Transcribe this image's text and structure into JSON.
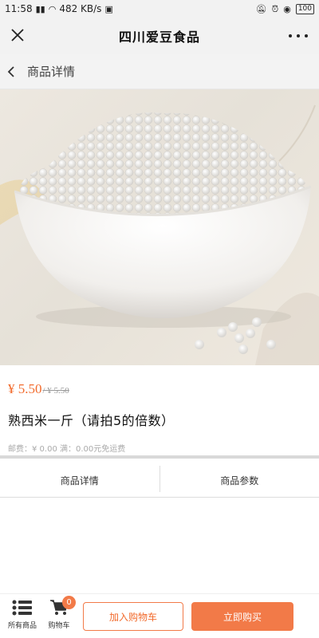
{
  "status_bar": {
    "time": "11:58",
    "net_speed": "482 KB/s",
    "battery": "100"
  },
  "title_bar": {
    "title": "四川爱豆食品",
    "close_icon": "close-icon",
    "more_icon": "more-icon"
  },
  "sub_header": {
    "title": "商品详情",
    "back_icon": "back-icon"
  },
  "product": {
    "price": "¥ 5.50",
    "old_price": "/ ¥ 5.50",
    "name": "熟西米一斤（请拍5的倍数）",
    "shipping": "邮费：¥ 0.00 满：0.00元免运费",
    "image": "white-tapioca-pearls-in-bowl"
  },
  "tabs": [
    {
      "label": "商品详情"
    },
    {
      "label": "商品参数"
    }
  ],
  "bottom_bar": {
    "all_products_label": "所有商品",
    "cart_label": "购物车",
    "cart_count": "0",
    "add_to_cart_label": "加入购物车",
    "buy_now_label": "立即购买"
  },
  "colors": {
    "accent": "#f27a48",
    "price": "#f26b2d",
    "header_bg": "#f2f2f2"
  }
}
